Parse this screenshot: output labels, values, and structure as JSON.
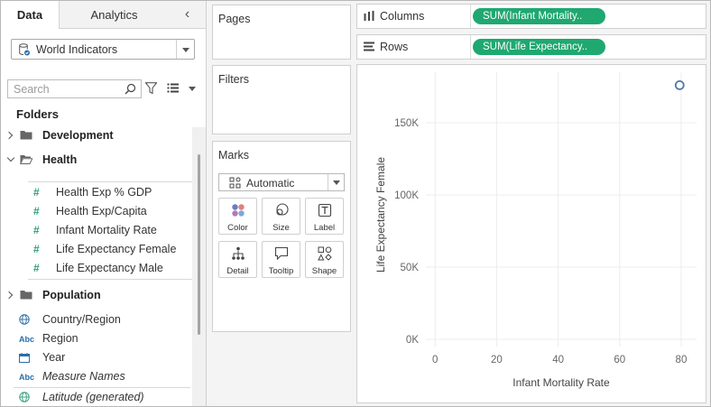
{
  "sidebar": {
    "tabs": {
      "data": "Data",
      "analytics": "Analytics"
    },
    "collapse_glyph": "‹",
    "datasource": "World Indicators",
    "search_placeholder": "Search",
    "folders_title": "Folders",
    "folders": {
      "development": "Development",
      "health": "Health",
      "population": "Population"
    },
    "health_fields": [
      "Health Exp % GDP",
      "Health Exp/Capita",
      "Infant Mortality Rate",
      "Life Expectancy Female",
      "Life Expectancy Male"
    ],
    "dimension_fields": {
      "country": "Country/Region",
      "region": "Region",
      "year": "Year",
      "measure_names": "Measure Names",
      "latitude": "Latitude (generated)"
    },
    "abc_glyph": "Abc",
    "hash_glyph": "#"
  },
  "cards": {
    "pages": "Pages",
    "filters": "Filters",
    "marks": "Marks",
    "mark_type": "Automatic",
    "mark_buttons": {
      "color": "Color",
      "size": "Size",
      "label": "Label",
      "detail": "Detail",
      "tooltip": "Tooltip",
      "shape": "Shape"
    }
  },
  "shelves": {
    "columns_label": "Columns",
    "rows_label": "Rows",
    "columns_pill": "SUM(Infant Mortality..",
    "rows_pill": "SUM(Life Expectancy.."
  },
  "icons": [
    "database-icon",
    "search-icon",
    "filter-icon",
    "view-list-icon",
    "folder-icon",
    "globe-icon",
    "calendar-icon",
    "columns-icon",
    "rows-icon",
    "automatic-mark-icon",
    "color-icon",
    "size-icon",
    "label-icon",
    "detail-icon",
    "tooltip-icon",
    "shape-icon"
  ],
  "colors": {
    "pill": "#1fa870",
    "measure": "#2e9e78",
    "dimension": "#2a6ea8",
    "mark": "#4e79a7"
  },
  "chart_data": {
    "type": "scatter",
    "xlabel": "Infant Mortality Rate",
    "ylabel": "Life Expectancy Female",
    "xlim": [
      -3,
      85
    ],
    "ylim": [
      -5000,
      185000
    ],
    "x_ticks": [
      0,
      20,
      40,
      60,
      80
    ],
    "x_tick_labels": [
      "0",
      "20",
      "40",
      "60",
      "80"
    ],
    "y_ticks": [
      0,
      50000,
      100000,
      150000
    ],
    "y_tick_labels": [
      "0K",
      "50K",
      "100K",
      "150K"
    ],
    "grid": true,
    "points": [
      {
        "x": 79.5,
        "y": 176000
      }
    ],
    "marker": "hollow-circle"
  }
}
